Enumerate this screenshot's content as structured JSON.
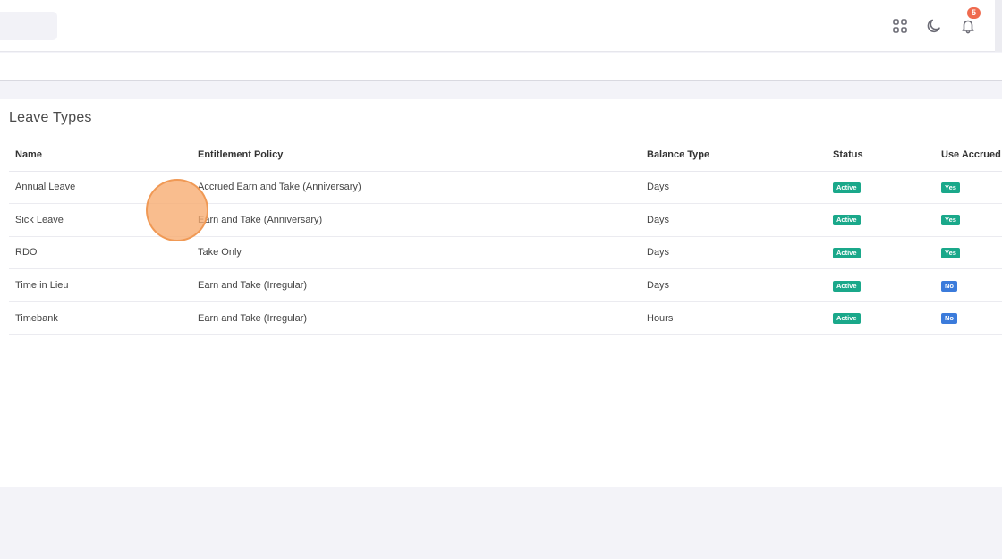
{
  "header": {
    "notification_count": "5",
    "icons": [
      "apps-grid-icon",
      "moon-icon",
      "bell-icon"
    ]
  },
  "card": {
    "title": "Leave Types"
  },
  "table": {
    "columns": [
      "Name",
      "Entitlement Policy",
      "Balance Type",
      "Status",
      "Use Accrued"
    ],
    "rows": [
      {
        "name": "Annual Leave",
        "policy": "Accrued Earn and Take (Anniversary)",
        "balance": "Days",
        "status": "Active",
        "use_accrued": "Yes"
      },
      {
        "name": "Sick Leave",
        "policy": "Earn and Take (Anniversary)",
        "balance": "Days",
        "status": "Active",
        "use_accrued": "Yes"
      },
      {
        "name": "RDO",
        "policy": "Take Only",
        "balance": "Days",
        "status": "Active",
        "use_accrued": "Yes"
      },
      {
        "name": "Time in Lieu",
        "policy": "Earn and Take (Irregular)",
        "balance": "Days",
        "status": "Active",
        "use_accrued": "No"
      },
      {
        "name": "Timebank",
        "policy": "Earn and Take (Irregular)",
        "balance": "Hours",
        "status": "Active",
        "use_accrued": "No"
      }
    ]
  },
  "colors": {
    "active": "#1aa88a",
    "yes": "#1aa88a",
    "no": "#3b7bdb",
    "badge": "#ef6b4f"
  }
}
